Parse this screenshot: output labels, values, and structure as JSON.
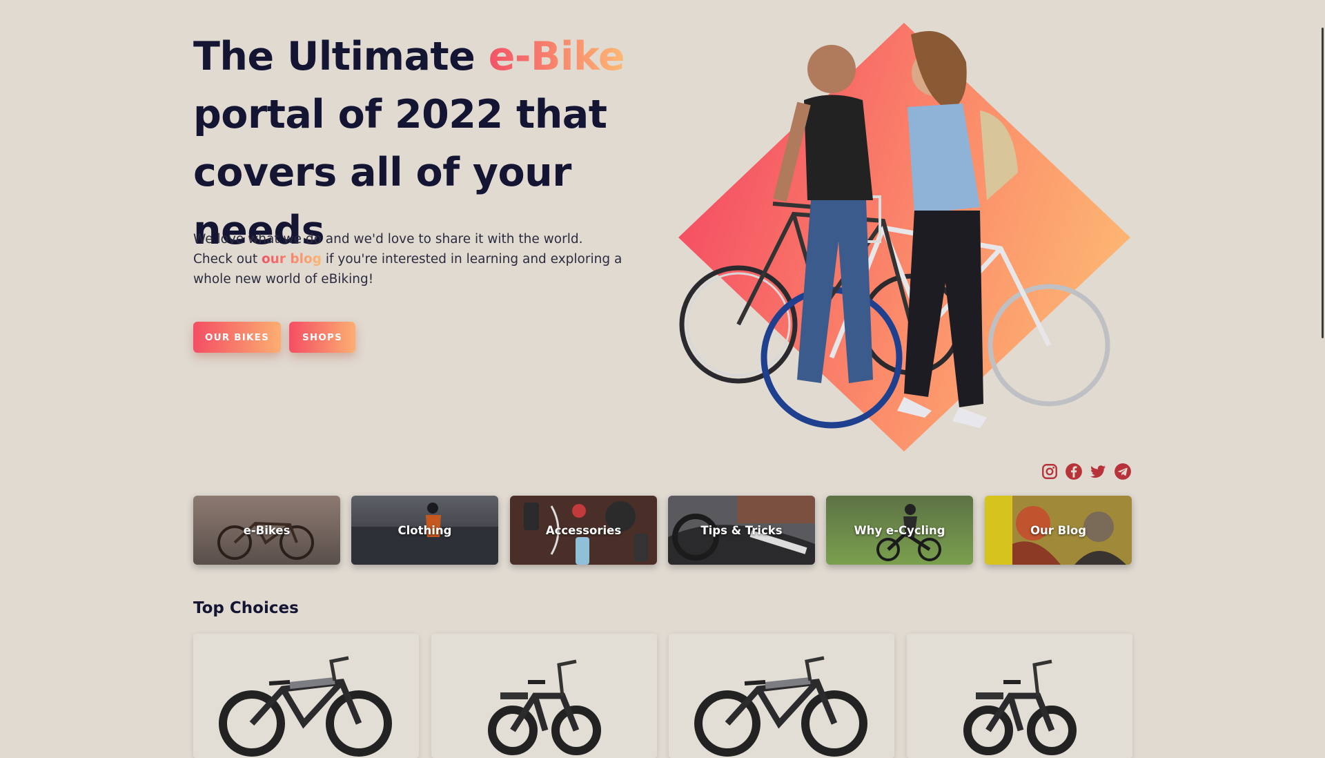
{
  "hero": {
    "title_part1": "The Ultimate ",
    "title_highlight": "e-Bike",
    "title_part2": " portal of 2022 that covers all of your needs",
    "desc_line1": "We love what we do and we'd love to share it with the world.",
    "desc_pre_link": "Check out ",
    "desc_link": "our blog",
    "desc_post_link": " if you're interested in learning and exploring a whole new world of eBiking!",
    "btn_bikes": "OUR BIKES",
    "btn_shops": "SHOPS"
  },
  "social": [
    "instagram-icon",
    "facebook-icon",
    "twitter-icon",
    "telegram-icon"
  ],
  "categories": [
    {
      "label": "e-Bikes"
    },
    {
      "label": "Clothing"
    },
    {
      "label": "Accessories"
    },
    {
      "label": "Tips & Tricks"
    },
    {
      "label": "Why e-Cycling"
    },
    {
      "label": "Our Blog"
    }
  ],
  "top_choices": {
    "title": "Top Choices"
  },
  "colors": {
    "background": "#e0dad1",
    "accent_start": "#f25367",
    "accent_end": "#fdb873",
    "text_dark": "#141433",
    "social_icon": "#b8323a"
  }
}
